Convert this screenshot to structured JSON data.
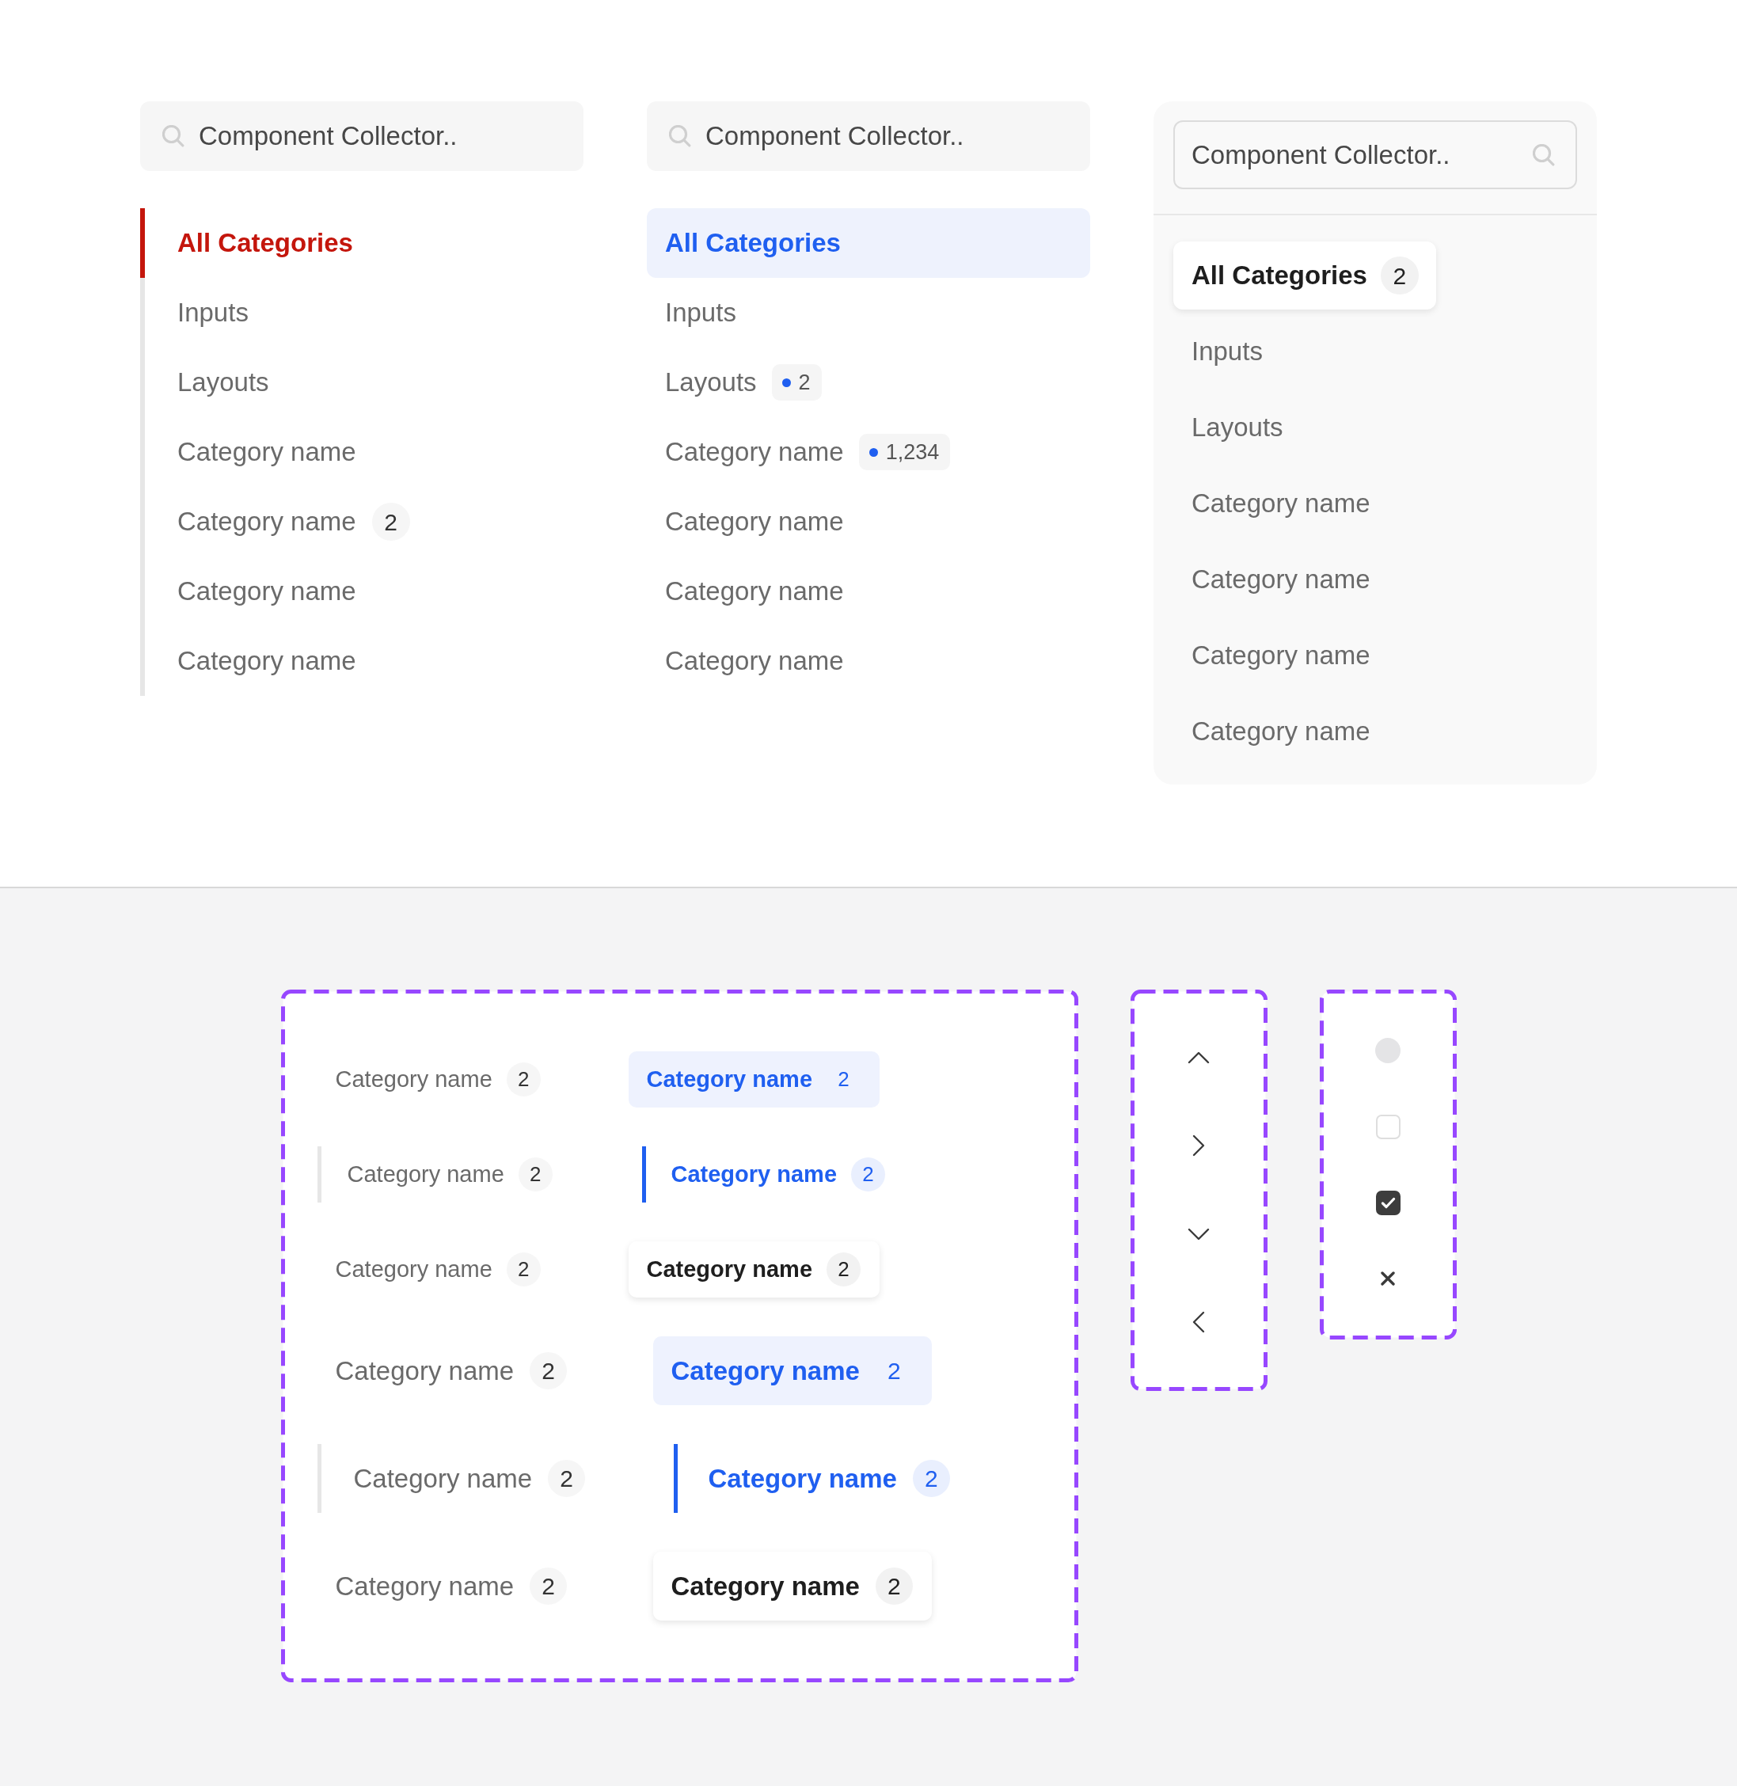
{
  "panels": [
    {
      "kind": "rail",
      "search": {
        "placeholder": "Component Collector.."
      },
      "items": [
        {
          "label": "All Categories",
          "selected": true
        },
        {
          "label": "Inputs",
          "selected": false
        },
        {
          "label": "Layouts",
          "selected": false
        },
        {
          "label": "Category name",
          "selected": false
        },
        {
          "label": "Category name",
          "selected": false,
          "badge": {
            "kind": "count",
            "text": "2"
          }
        },
        {
          "label": "Category name",
          "selected": false
        },
        {
          "label": "Category name",
          "selected": false
        }
      ]
    },
    {
      "kind": "fill",
      "search": {
        "placeholder": "Component Collector.."
      },
      "items": [
        {
          "label": "All Categories",
          "selected": true
        },
        {
          "label": "Inputs",
          "selected": false
        },
        {
          "label": "Layouts",
          "selected": false,
          "badge": {
            "kind": "dot",
            "text": "2"
          }
        },
        {
          "label": "Category name",
          "selected": false,
          "badge": {
            "kind": "dot",
            "text": "1,234"
          }
        },
        {
          "label": "Category name",
          "selected": false
        },
        {
          "label": "Category name",
          "selected": false
        },
        {
          "label": "Category name",
          "selected": false
        }
      ]
    },
    {
      "kind": "card",
      "search": {
        "placeholder": "Component Collector.."
      },
      "items": [
        {
          "label": "All Categories",
          "selected": true,
          "badge": {
            "kind": "count",
            "text": "2"
          }
        },
        {
          "label": "Inputs",
          "selected": false
        },
        {
          "label": "Layouts",
          "selected": false
        },
        {
          "label": "Category name",
          "selected": false
        },
        {
          "label": "Category name",
          "selected": false
        },
        {
          "label": "Category name",
          "selected": false
        },
        {
          "label": "Category name",
          "selected": false
        }
      ]
    }
  ],
  "variant_groups": [
    {
      "kind": "small",
      "rows": [
        {
          "kind": "fill",
          "items": [
            {
              "label": "Category name",
              "count": "2",
              "selected": false
            },
            {
              "label": "Category name",
              "count": "2",
              "selected": true
            }
          ]
        },
        {
          "kind": "rail",
          "items": [
            {
              "label": "Category name",
              "count": "2",
              "selected": false
            },
            {
              "label": "Category name",
              "count": "2",
              "selected": true
            }
          ]
        },
        {
          "kind": "card",
          "items": [
            {
              "label": "Category name",
              "count": "2",
              "selected": false
            },
            {
              "label": "Category name",
              "count": "2",
              "selected": true
            }
          ]
        }
      ]
    },
    {
      "kind": "large",
      "rows": [
        {
          "kind": "fill",
          "items": [
            {
              "label": "Category name",
              "count": "2",
              "selected": false
            },
            {
              "label": "Category name",
              "count": "2",
              "selected": true
            }
          ]
        },
        {
          "kind": "rail",
          "items": [
            {
              "label": "Category name",
              "count": "2",
              "selected": false
            },
            {
              "label": "Category name",
              "count": "2",
              "selected": true
            }
          ]
        },
        {
          "kind": "card",
          "items": [
            {
              "label": "Category name",
              "count": "2",
              "selected": false
            },
            {
              "label": "Category name",
              "count": "2",
              "selected": true
            }
          ]
        }
      ]
    }
  ],
  "indicators": [
    {
      "kind": "disc"
    },
    {
      "kind": "checkbox",
      "checked": false
    },
    {
      "kind": "checkbox",
      "checked": true
    },
    {
      "kind": "cross"
    }
  ]
}
